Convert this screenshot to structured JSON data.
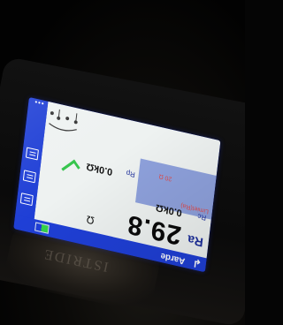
{
  "meter": {
    "brand": "ISTRIDE",
    "back_glyph": "↲",
    "back_label": "Aarde",
    "ra": {
      "label": "Ra",
      "value": "29.8",
      "unit": "Ω"
    },
    "rc": {
      "label": "Rc",
      "value": "0.0kΩ"
    },
    "rp": {
      "label": "Rp",
      "value": "0.0kΩ"
    },
    "limits": {
      "label": "Limiet(Ra)",
      "value": "20 Ω"
    },
    "dots": "•••",
    "battery_level": 0.55,
    "colors": {
      "screen_blue": "#1f3fd6",
      "panel_blue": "#8ea1dc",
      "check_green": "#33c44a",
      "limit_red": "#e14848"
    },
    "icons": [
      "back-arrow-icon",
      "list-icon",
      "document-icon",
      "save-icon",
      "checkmark-icon",
      "battery-icon",
      "circuit-diagram-icon"
    ]
  }
}
